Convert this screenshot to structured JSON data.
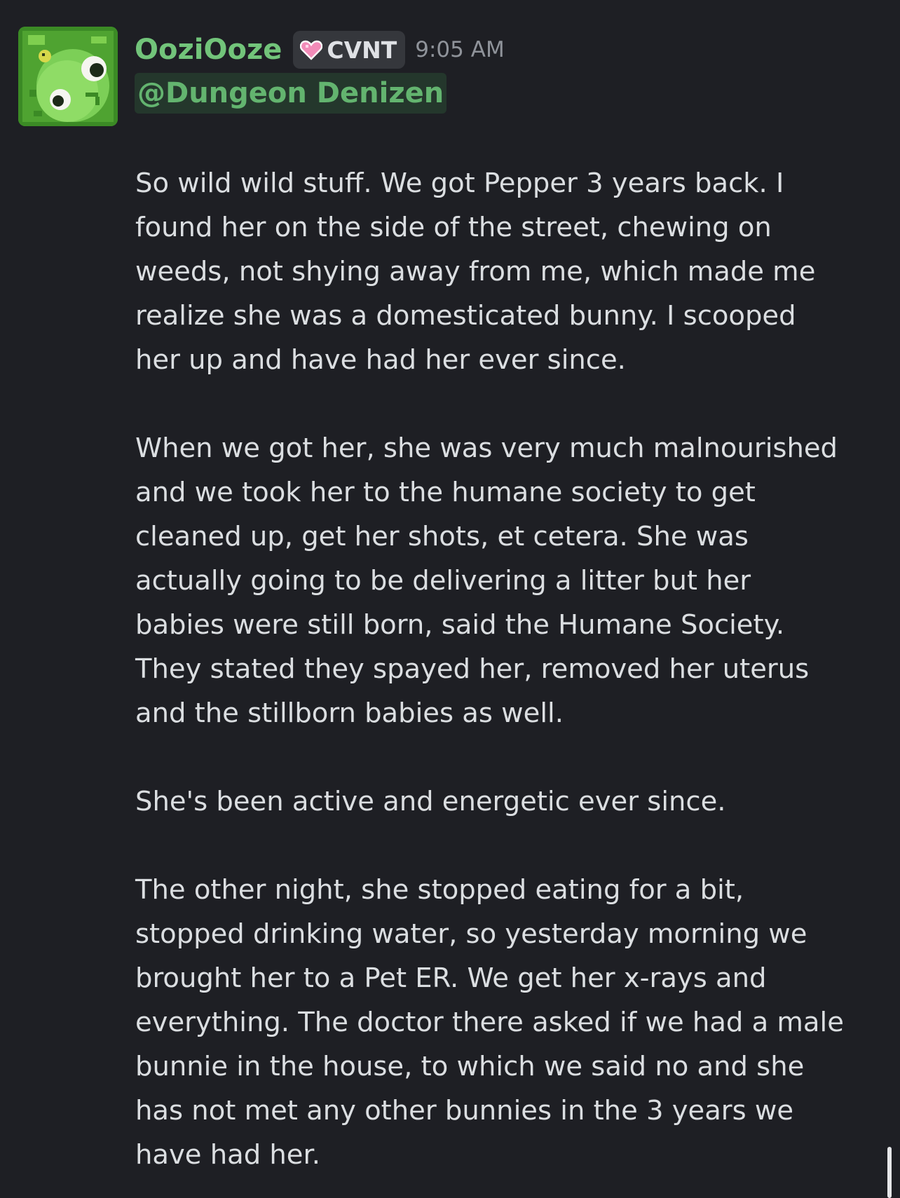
{
  "message": {
    "author": "OoziOoze",
    "role_tag": "CVNT",
    "timestamp": "9:05 AM",
    "mention": "@Dungeon Denizen",
    "paragraphs": [
      [
        "So wild wild stuff. We got Pepper 3 years back. I",
        "found her on the side of the street, chewing on",
        "weeds, not shying away from me, which made me",
        "realize she was a domesticated bunny. I scooped",
        "her up and have had her ever since."
      ],
      [
        "When we got her, she was very much malnourished",
        "and we took her to the humane society to get",
        "cleaned up, get her shots, et cetera. She was",
        "actually going to be delivering a litter but her",
        "babies were still born, said the Humane Society.",
        "They stated they spayed her, removed her uterus",
        "and the stillborn babies as well."
      ],
      [
        "She's been active and energetic ever since."
      ],
      [
        "The other night, she stopped eating for a bit,",
        "stopped drinking water, so yesterday morning we",
        "brought her to a Pet ER. We get her x-rays and",
        "everything. The doctor there asked if we had a male",
        "bunnie in the house, to which we said no and she",
        "has not met any other bunnies in the 3 years we",
        "have had her."
      ]
    ]
  },
  "icons": {
    "avatar": "green-slime-pixel-avatar",
    "tag_icon": "pink-heart-icon"
  },
  "colors": {
    "background": "#1e1f24",
    "username": "#72c47a",
    "mention_text": "#63b46f",
    "mention_bg": "#24372c",
    "body_text": "#dbdee1",
    "timestamp": "#8f939a",
    "tag_bg": "#35373c",
    "heart": "#f28bb8"
  }
}
